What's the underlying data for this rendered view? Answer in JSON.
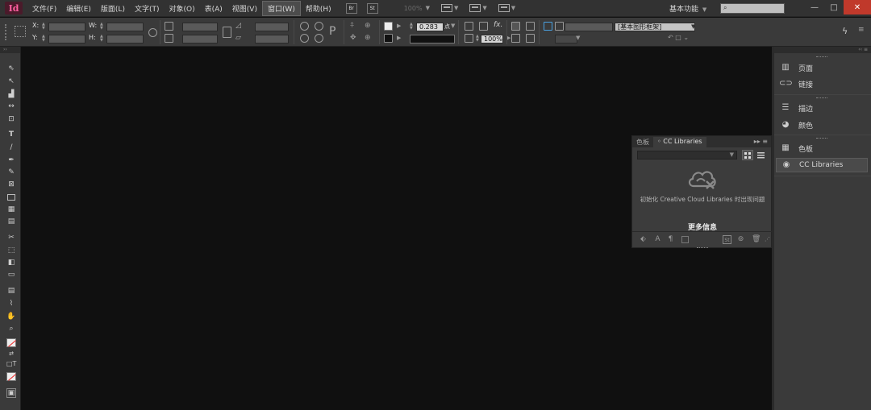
{
  "app": {
    "logo_text": "Id",
    "menu": [
      "文件(F)",
      "编辑(E)",
      "版面(L)",
      "文字(T)",
      "对象(O)",
      "表(A)",
      "视图(V)",
      "窗口(W)",
      "帮助(H)"
    ],
    "active_menu_index": 7,
    "bridge_label": "Br",
    "stock_label": "St",
    "zoom_level": "100%",
    "workspace": "基本功能",
    "help_search_placeholder": "",
    "window_controls": [
      "—",
      "□",
      "✕"
    ]
  },
  "control_panel": {
    "x_label": "X:",
    "y_label": "Y:",
    "w_label": "W:",
    "h_label": "H:",
    "stroke_weight": "0.283",
    "stroke_unit": "点",
    "opacity": "100%",
    "paragraph_style": "[基本图形框架]"
  },
  "cc_panel": {
    "tabs": [
      "色板",
      "CC Libraries"
    ],
    "active_tab_index": 1,
    "message": "初始化 Creative Cloud Libraries 时出现问题",
    "more_info": "更多信息",
    "icons": [
      "cloud-error-icon",
      "grid-view-icon",
      "list-view-icon"
    ]
  },
  "dock": {
    "items": [
      {
        "label": "页面",
        "icon": "pages-icon"
      },
      {
        "label": "链接",
        "icon": "links-icon"
      },
      {
        "label": "描边",
        "icon": "stroke-icon"
      },
      {
        "label": "颜色",
        "icon": "color-icon"
      },
      {
        "label": "色板",
        "icon": "swatches-icon"
      },
      {
        "label": "CC Libraries",
        "icon": "cc-libraries-icon"
      }
    ],
    "active_index": 5
  },
  "colors": {
    "accent_logo": "#ff5fa0",
    "canvas_bg": "#101010",
    "panel_bg": "#3a3a3a",
    "close_button": "#c0392b"
  }
}
